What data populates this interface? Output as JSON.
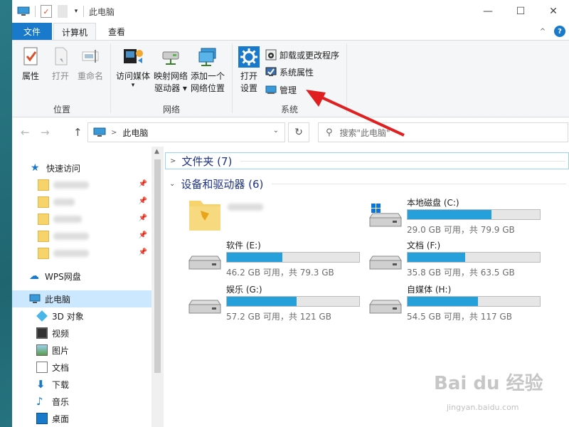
{
  "window": {
    "title": "此电脑",
    "controls": {
      "minimize": "—",
      "maximize": "☐",
      "close": "✕"
    }
  },
  "quick_access_toolbar": {
    "dropdown": "▾"
  },
  "tabs": [
    {
      "label": "文件"
    },
    {
      "label": "计算机"
    },
    {
      "label": "查看"
    }
  ],
  "tab_right": {
    "collapse": "^",
    "help": "?"
  },
  "ribbon": {
    "groups": {
      "location": {
        "label": "位置",
        "buttons": [
          {
            "label": "属性",
            "enabled": true
          },
          {
            "label": "打开",
            "enabled": false
          },
          {
            "label": "重命名",
            "enabled": false
          }
        ]
      },
      "network": {
        "label": "网络",
        "buttons": [
          {
            "label": "访问媒体",
            "caret": "▾"
          },
          {
            "label_line1": "映射网络",
            "label_line2": "驱动器 ▾"
          },
          {
            "label_line1": "添加一个",
            "label_line2": "网络位置"
          }
        ]
      },
      "system": {
        "label": "系统",
        "open_settings": {
          "label_line1": "打开",
          "label_line2": "设置"
        },
        "small_buttons": [
          {
            "label": "卸载或更改程序"
          },
          {
            "label": "系统属性"
          },
          {
            "label": "管理"
          }
        ]
      }
    }
  },
  "navigation": {
    "back": "←",
    "forward": "→",
    "up": "↑",
    "address_sep": ">",
    "address_path": "此电脑",
    "address_dropdown": "⌄",
    "refresh": "↻",
    "search_icon": "⚲",
    "search_placeholder": "搜索\"此电脑\""
  },
  "sidebar": {
    "quick_access": "快速访问",
    "pinned_folder_count": 5,
    "pin_glyph": "📌",
    "wps": "WPS网盘",
    "this_pc": "此电脑",
    "items": [
      {
        "label": "3D 对象"
      },
      {
        "label": "视频"
      },
      {
        "label": "图片"
      },
      {
        "label": "文档"
      },
      {
        "label": "下载"
      },
      {
        "label": "音乐"
      },
      {
        "label": "桌面"
      }
    ]
  },
  "content": {
    "folders_section": {
      "label": "文件夹 (7)",
      "chevron": ">"
    },
    "devices_section": {
      "label": "设备和驱动器 (6)",
      "chevron": "⌄"
    },
    "drives": [
      {
        "name": "本地磁盘 (C:)",
        "info": "29.0 GB 可用，共 79.9 GB",
        "used_fraction": 0.637,
        "os_drive": true
      },
      {
        "name": "软件 (E:)",
        "info": "46.2 GB 可用，共 79.3 GB",
        "used_fraction": 0.417
      },
      {
        "name": "文档 (F:)",
        "info": "35.8 GB 可用，共 63.5 GB",
        "used_fraction": 0.436
      },
      {
        "name": "娱乐 (G:)",
        "info": "57.2 GB 可用，共 121 GB",
        "used_fraction": 0.527
      },
      {
        "name": "自媒体 (H:)",
        "info": "54.5 GB 可用，共 117 GB",
        "used_fraction": 0.534
      }
    ]
  },
  "colors": {
    "accent": "#1979ca",
    "bar_fill": "#26a0da",
    "annotation_arrow": "#e02020"
  },
  "watermark": {
    "main": "Bai du 经验",
    "sub": "jingyan.baidu.com"
  }
}
